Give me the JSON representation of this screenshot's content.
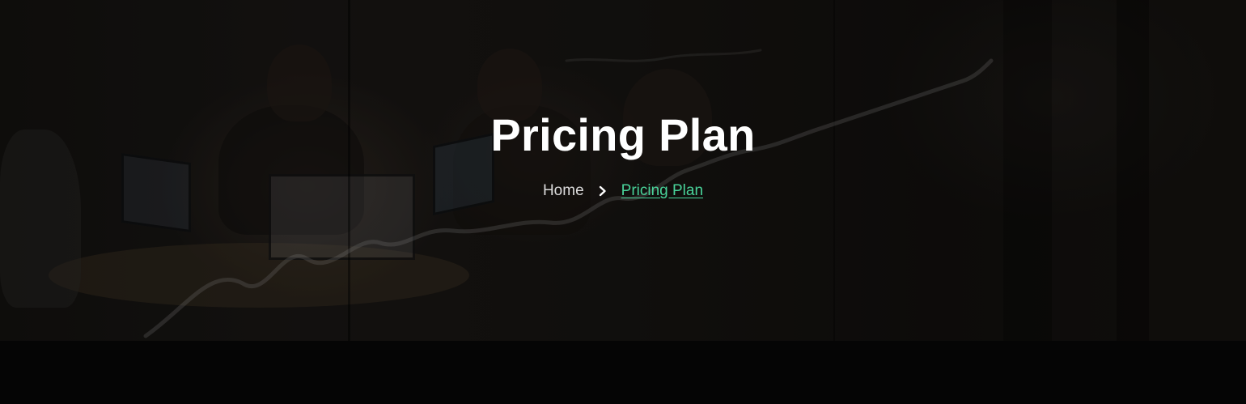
{
  "hero": {
    "title": "Pricing Plan",
    "breadcrumb": {
      "home_label": "Home",
      "separator_icon": "chevron-right-icon",
      "current_label": "Pricing Plan"
    }
  },
  "colors": {
    "title": "#ffffff",
    "breadcrumb_home": "#dcdcdc",
    "breadcrumb_current": "#49d39a",
    "bottom_band": "#050505"
  }
}
